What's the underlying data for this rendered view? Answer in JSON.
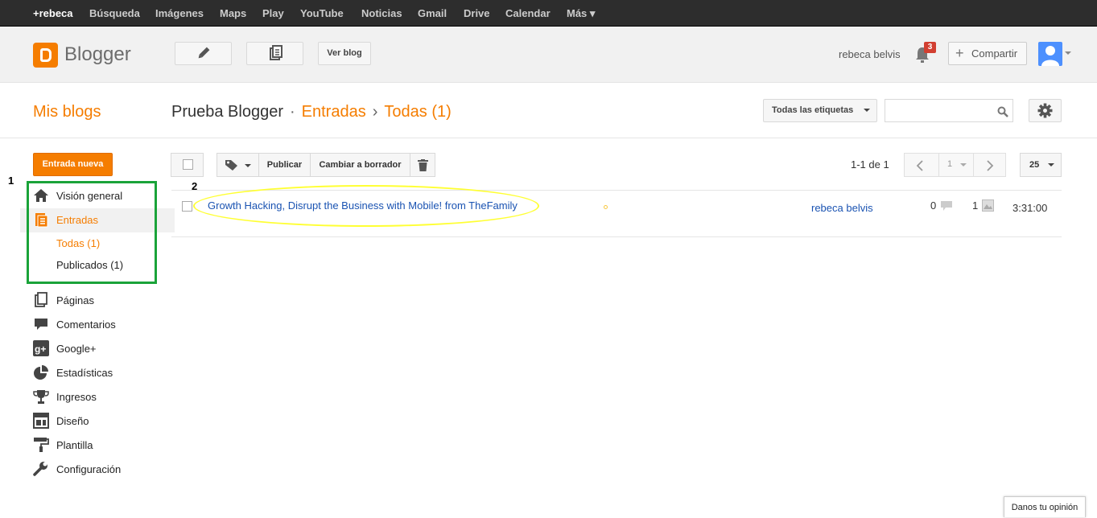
{
  "gbar": {
    "items": [
      "+rebeca",
      "Búsqueda",
      "Imágenes",
      "Maps",
      "Play",
      "YouTube",
      "Noticias",
      "Gmail",
      "Drive",
      "Calendar",
      "Más ▾"
    ]
  },
  "header": {
    "logo_text": "Blogger",
    "view_blog": "Ver blog",
    "user_name": "rebeca belvis",
    "notif_count": "3",
    "share_label": "Compartir"
  },
  "titlebar": {
    "my_blogs": "Mis blogs",
    "blog_name": "Prueba Blogger",
    "dot_sep": "·",
    "section": "Entradas",
    "arrow_sep": "›",
    "subsection": "Todas (1)",
    "labels_filter": "Todas las etiquetas",
    "search_value": ""
  },
  "sidebar": {
    "new_post": "Entrada nueva",
    "items": [
      {
        "label": "Visión general",
        "icon": "home-icon"
      },
      {
        "label": "Entradas",
        "icon": "posts-icon"
      },
      {
        "label": "Todas (1)",
        "icon": ""
      },
      {
        "label": "Publicados (1)",
        "icon": ""
      },
      {
        "label": "Páginas",
        "icon": "pages-icon"
      },
      {
        "label": "Comentarios",
        "icon": "comments-icon"
      },
      {
        "label": "Google+",
        "icon": "google-plus-icon"
      },
      {
        "label": "Estadísticas",
        "icon": "stats-icon"
      },
      {
        "label": "Ingresos",
        "icon": "trophy-icon"
      },
      {
        "label": "Diseño",
        "icon": "layout-icon"
      },
      {
        "label": "Plantilla",
        "icon": "template-icon"
      },
      {
        "label": "Configuración",
        "icon": "wrench-icon"
      }
    ]
  },
  "annotations": {
    "one": "1",
    "two": "2"
  },
  "toolbar": {
    "publish": "Publicar",
    "draft": "Cambiar a borrador",
    "range": "1-1 de 1",
    "page": "1",
    "per_page": "25"
  },
  "posts": [
    {
      "title": "Growth Hacking, Disrupt the Business with Mobile! from TheFamily",
      "author": "rebeca belvis",
      "comments": "0",
      "views": "1",
      "time": "3:31:00"
    }
  ],
  "feedback": "Danos tu opinión"
}
